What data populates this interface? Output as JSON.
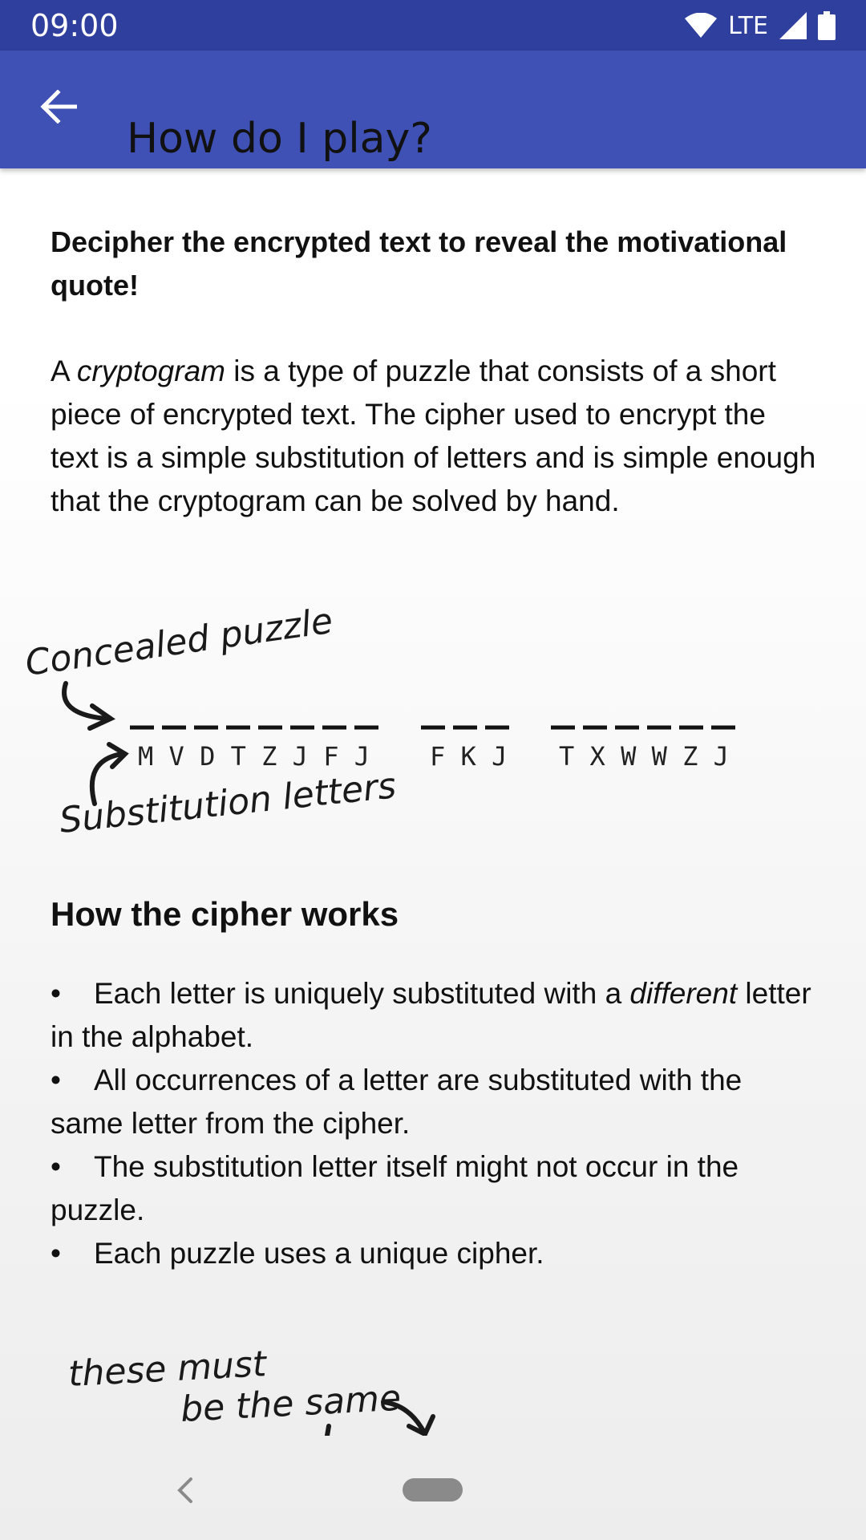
{
  "status_bar": {
    "time": "09:00",
    "network": "LTE"
  },
  "app_bar": {
    "title": "How do I play?",
    "back_icon": "arrow-back-icon"
  },
  "intro": {
    "lead": "Decipher the encrypted text to reveal the motivational quote!",
    "paragraph_before": "A ",
    "paragraph_emphasis": "cryptogram",
    "paragraph_after": " is a type of puzzle that consists of a short piece of encrypted text. The cipher used to encrypt the text is a simple substitution of letters and is simple enough that the cryptogram can be solved by hand."
  },
  "diagram": {
    "annotation_concealed": "Concealed puzzle",
    "annotation_substitution": "Substitution letters",
    "words": [
      {
        "letters": "M V D T Z J F J"
      },
      {
        "letters": "F K J"
      },
      {
        "letters": "T X W W Z J"
      }
    ]
  },
  "cipher_section": {
    "heading": "How the cipher works",
    "bullets": [
      {
        "before": "Each letter is uniquely substituted with a ",
        "emphasis": "different",
        "after": " letter in the alphabet."
      },
      {
        "before": "All occurrences of a letter are substituted with the same letter from the cipher.",
        "emphasis": "",
        "after": ""
      },
      {
        "before": "The substitution letter itself might not occur in the puzzle.",
        "emphasis": "",
        "after": ""
      },
      {
        "before": "Each puzzle uses a unique cipher.",
        "emphasis": "",
        "after": ""
      }
    ],
    "bullet_symbol": "•"
  },
  "diagram2": {
    "annotation_line1": "these must",
    "annotation_line2": "be the same"
  },
  "colors": {
    "status_bar": "#2f3f9e",
    "app_bar": "#3f51b5"
  }
}
